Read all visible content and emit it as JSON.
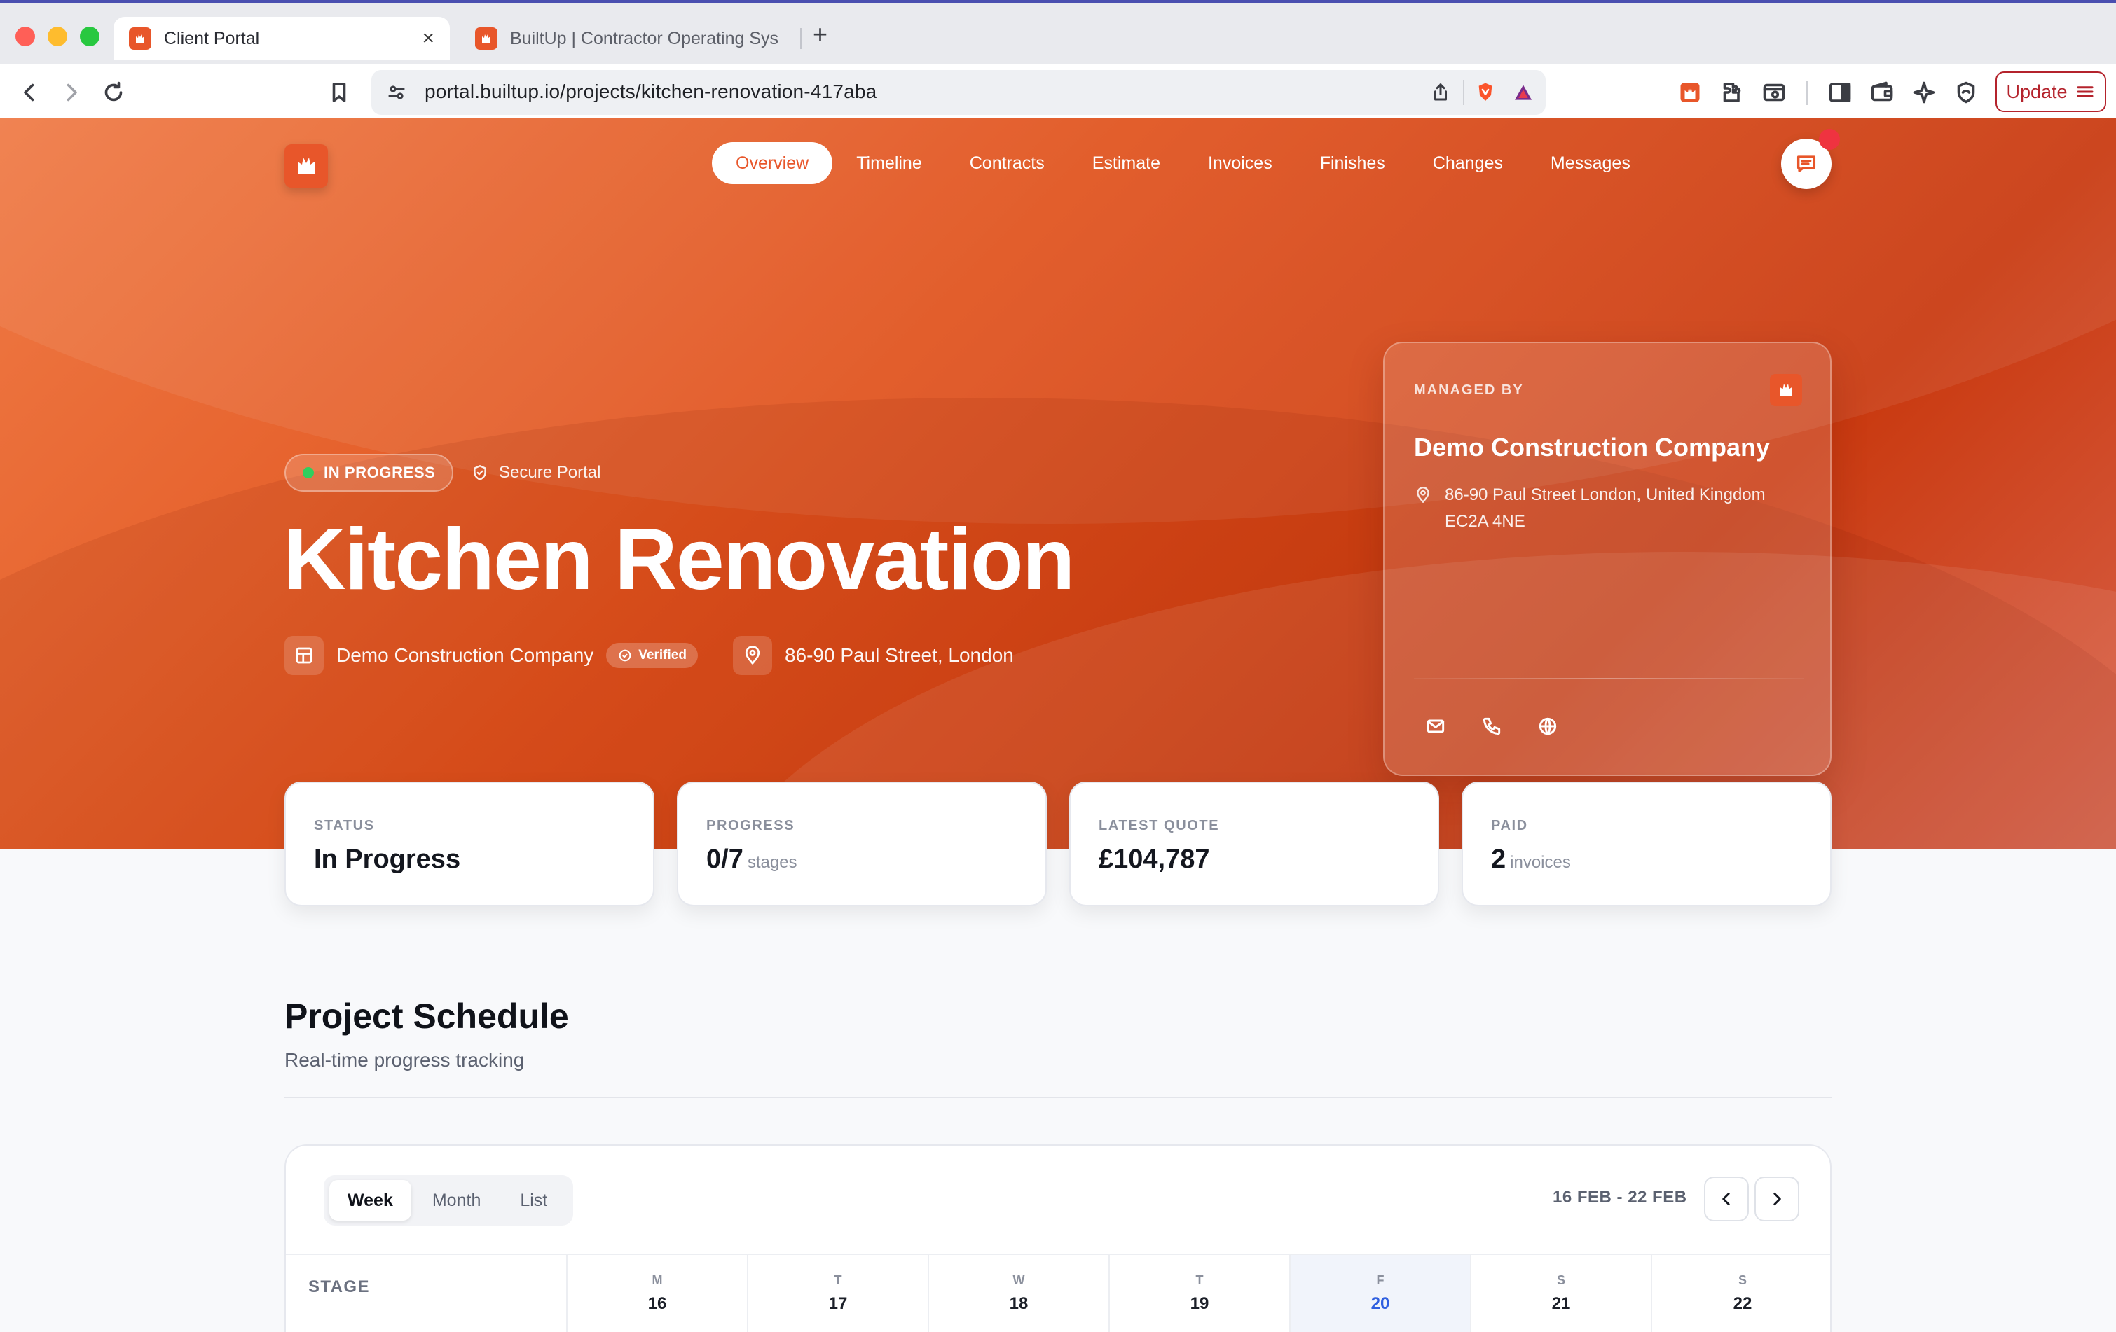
{
  "browser": {
    "tabs": [
      {
        "title": "Client Portal",
        "active": true
      },
      {
        "title": "BuiltUp | Contractor Operating Sys",
        "active": false
      }
    ],
    "new_tab_symbol": "+",
    "url": "portal.builtup.io/projects/kitchen-renovation-417aba",
    "update_label": "Update",
    "colors": {
      "close": "#ff5f57",
      "minimize": "#febc2e",
      "maximize": "#28c840",
      "update": "#b4232c"
    }
  },
  "nav": {
    "items": [
      "Overview",
      "Timeline",
      "Contracts",
      "Estimate",
      "Invoices",
      "Finishes",
      "Changes",
      "Messages"
    ],
    "active_index": 0
  },
  "hero": {
    "status_badge": "IN PROGRESS",
    "secure_label": "Secure Portal",
    "title": "Kitchen Renovation",
    "company": "Demo Construction Company",
    "verified_label": "Verified",
    "address_short": "86-90 Paul Street, London",
    "accent": "#e8562a"
  },
  "managed_by": {
    "label": "MANAGED BY",
    "company": "Demo Construction Company",
    "address": "86-90 Paul Street London, United Kingdom EC2A 4NE",
    "contact_icons": [
      "mail-icon",
      "phone-icon",
      "globe-icon"
    ]
  },
  "stats": [
    {
      "label": "STATUS",
      "value": "In Progress",
      "unit": ""
    },
    {
      "label": "PROGRESS",
      "value": "0/7",
      "unit": "stages"
    },
    {
      "label": "LATEST QUOTE",
      "value": "£104,787",
      "unit": ""
    },
    {
      "label": "PAID",
      "value": "2",
      "unit": "invoices"
    }
  ],
  "schedule": {
    "title": "Project Schedule",
    "subtitle": "Real-time progress tracking",
    "views": [
      "Week",
      "Month",
      "List"
    ],
    "active_view": "Week",
    "range": "16 FEB - 22 FEB",
    "stage_header": "STAGE",
    "days": [
      {
        "letter": "M",
        "num": "16"
      },
      {
        "letter": "T",
        "num": "17"
      },
      {
        "letter": "W",
        "num": "18"
      },
      {
        "letter": "T",
        "num": "19"
      },
      {
        "letter": "F",
        "num": "20",
        "today": true
      },
      {
        "letter": "S",
        "num": "21"
      },
      {
        "letter": "S",
        "num": "22"
      }
    ]
  }
}
